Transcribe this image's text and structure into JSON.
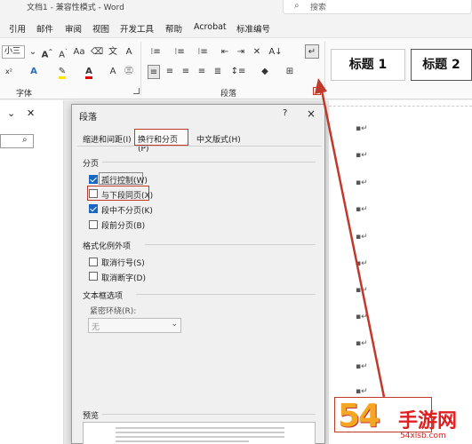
{
  "titlebar": {
    "title": "文档1 - 兼容性模式 - Word",
    "search_placeholder": "搜索"
  },
  "menu": {
    "tabs": [
      "引用",
      "邮件",
      "审阅",
      "视图",
      "开发工具",
      "帮助",
      "Acrobat",
      "标准编号"
    ]
  },
  "ribbon": {
    "font_size": "小三",
    "font_group_label": "字体",
    "paragraph_group_label": "段落",
    "styles": [
      "标题 1",
      "标题 2"
    ]
  },
  "dialog": {
    "title": "段落",
    "help": "?",
    "close": "×",
    "tabs": [
      "缩进和间距(I)",
      "换行和分页(P)",
      "中文版式(H)"
    ],
    "pagination": {
      "heading": "分页",
      "options": [
        {
          "label": "孤行控制(W)",
          "checked": true
        },
        {
          "label": "与下段同页(X)",
          "checked": false
        },
        {
          "label": "段中不分页(K)",
          "checked": true
        },
        {
          "label": "段前分页(B)",
          "checked": false
        }
      ]
    },
    "format_exceptions": {
      "heading": "格式化例外项",
      "options": [
        {
          "label": "取消行号(S)",
          "checked": false
        },
        {
          "label": "取消断字(D)",
          "checked": false
        }
      ]
    },
    "textbox": {
      "heading": "文本框选项",
      "wrap_label": "紧密环绕(R):",
      "wrap_value": "无"
    },
    "preview_heading": "预览"
  },
  "watermark": {
    "big": "54",
    "cn": "手游网",
    "url": "54xlsb.com"
  },
  "colors": {
    "annotation": "#c0392b",
    "checkbox_checked": "#1a66c7"
  }
}
